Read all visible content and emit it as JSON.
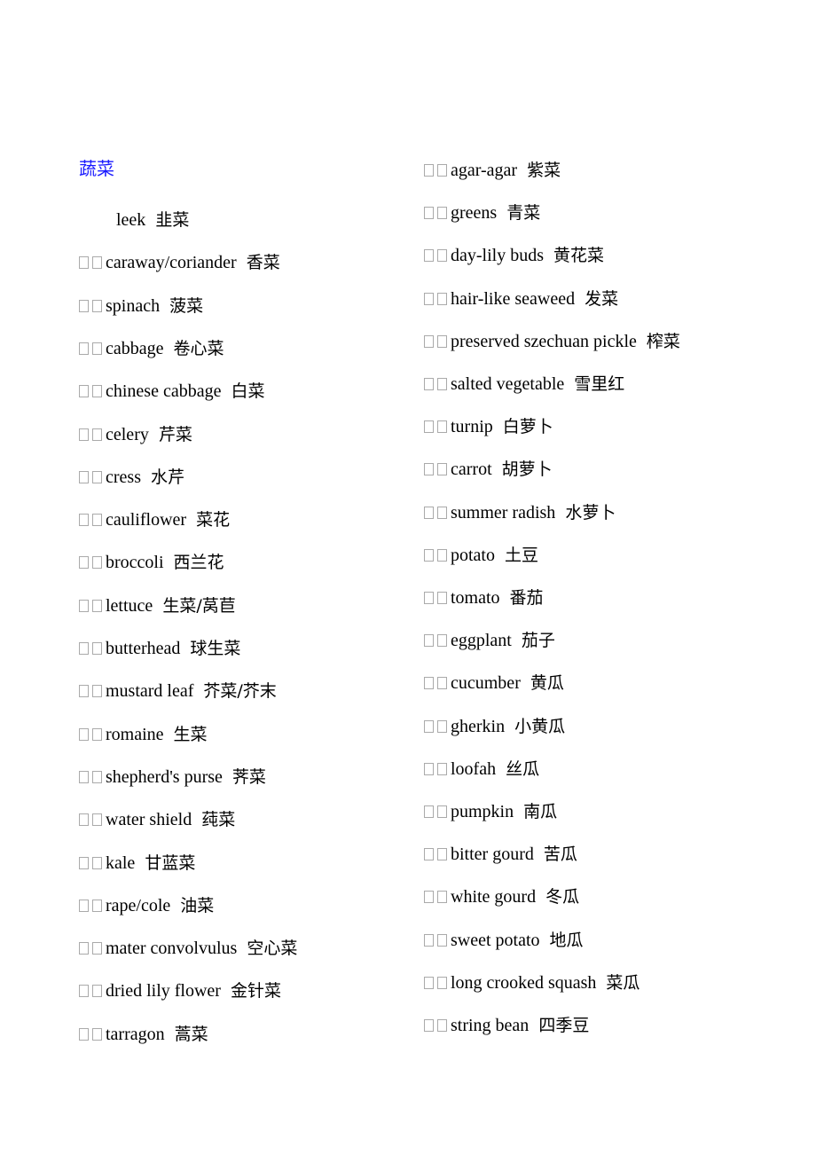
{
  "heading": {
    "text": "蔬菜",
    "color": "#1a1aff"
  },
  "left_column": [
    {
      "en": "leek",
      "zh": "韭菜",
      "boxes": false
    },
    {
      "en": "caraway/coriander",
      "zh": "香菜",
      "boxes": true
    },
    {
      "en": "spinach",
      "zh": "菠菜",
      "boxes": true
    },
    {
      "en": "cabbage",
      "zh": "卷心菜",
      "boxes": true
    },
    {
      "en": "chinese cabbage",
      "zh": "白菜",
      "boxes": true
    },
    {
      "en": "celery",
      "zh": "芹菜",
      "boxes": true
    },
    {
      "en": "cress",
      "zh": "水芹",
      "boxes": true
    },
    {
      "en": "cauliflower",
      "zh": "菜花",
      "boxes": true
    },
    {
      "en": "broccoli",
      "zh": "西兰花",
      "boxes": true
    },
    {
      "en": "lettuce",
      "zh": "生菜/莴苣",
      "boxes": true
    },
    {
      "en": "butterhead",
      "zh": "球生菜",
      "boxes": true
    },
    {
      "en": "mustard leaf",
      "zh": "芥菜/芥末",
      "boxes": true
    },
    {
      "en": "romaine",
      "zh": "生菜",
      "boxes": true
    },
    {
      "en": "shepherd's purse",
      "zh": "荠菜",
      "boxes": true
    },
    {
      "en": "water shield",
      "zh": "莼菜",
      "boxes": true
    },
    {
      "en": "kale",
      "zh": "甘蓝菜",
      "boxes": true
    },
    {
      "en": "rape/cole",
      "zh": "油菜",
      "boxes": true
    },
    {
      "en": "mater convolvulus",
      "zh": "空心菜",
      "boxes": true
    },
    {
      "en": "dried lily flower",
      "zh": "金针菜",
      "boxes": true
    },
    {
      "en": "tarragon",
      "zh": "蒿菜",
      "boxes": true
    }
  ],
  "right_column": [
    {
      "en": "agar-agar",
      "zh": "紫菜"
    },
    {
      "en": "greens",
      "zh": "青菜"
    },
    {
      "en": "day-lily buds",
      "zh": "黄花菜"
    },
    {
      "en": "hair-like seaweed",
      "zh": "发菜"
    },
    {
      "en": "preserved szechuan pickle",
      "zh": "榨菜"
    },
    {
      "en": "salted vegetable",
      "zh": "雪里红"
    },
    {
      "en": "turnip",
      "zh": "白萝卜"
    },
    {
      "en": "carrot",
      "zh": "胡萝卜"
    },
    {
      "en": "summer radish",
      "zh": "水萝卜"
    },
    {
      "en": "potato",
      "zh": "土豆"
    },
    {
      "en": "tomato",
      "zh": "番茄"
    },
    {
      "en": "eggplant",
      "zh": "茄子"
    },
    {
      "en": "cucumber",
      "zh": "黄瓜"
    },
    {
      "en": "gherkin",
      "zh": "小黄瓜"
    },
    {
      "en": "loofah",
      "zh": "丝瓜"
    },
    {
      "en": "pumpkin",
      "zh": "南瓜"
    },
    {
      "en": "bitter gourd",
      "zh": "苦瓜"
    },
    {
      "en": "white gourd",
      "zh": "冬瓜"
    },
    {
      "en": "sweet potato",
      "zh": "地瓜"
    },
    {
      "en": "long crooked squash",
      "zh": "菜瓜"
    },
    {
      "en": "string bean",
      "zh": "四季豆"
    }
  ]
}
